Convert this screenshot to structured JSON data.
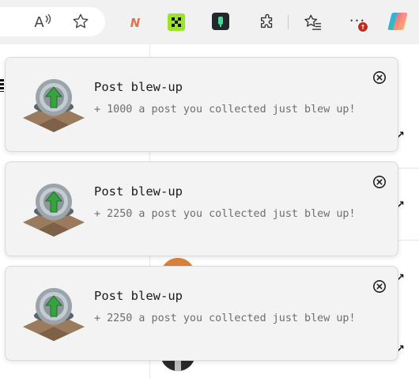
{
  "toolbar": {
    "icons": [
      "read-aloud-icon",
      "favorite-star-icon",
      "extension-n-icon",
      "extension-green-icon",
      "extension-dark-icon",
      "extensions-puzzle-icon",
      "favorites-icon",
      "more-icon",
      "copilot-icon"
    ],
    "read_aloud_glyph": "A",
    "extension_n_glyph": "N",
    "more_glyph": "···",
    "more_badge_glyph": "↑",
    "colors": {
      "bar": "#f1f1f1",
      "badge": "#c42b1c",
      "ext_green": "#9be22d",
      "ext_dark": "#23262b"
    }
  },
  "notifications": [
    {
      "title": "Post blew-up",
      "message": "+ 1000 a post you collected just blew up!",
      "icon": "post-blew-up-icon",
      "close_icon": "close-circle-icon"
    },
    {
      "title": "Post blew-up",
      "message": "+ 2250 a post you collected just blew up!",
      "icon": "post-blew-up-icon",
      "close_icon": "close-circle-icon"
    },
    {
      "title": "Post blew-up",
      "message": "+ 2250 a post you collected just blew up!",
      "icon": "post-blew-up-icon",
      "close_icon": "close-circle-icon"
    }
  ],
  "background": {
    "arrow_glyph": "↗"
  }
}
